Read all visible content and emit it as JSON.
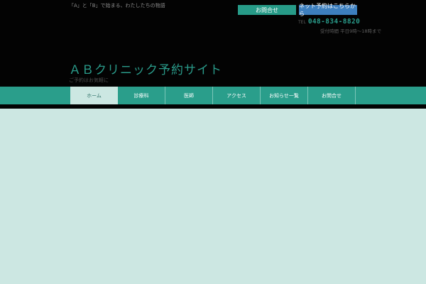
{
  "header": {
    "tagline": "「A」と「B」で始まる、わたしたちの物語",
    "contact_label": "お問合せ",
    "reserve_label": "ネット予約はこちらから",
    "phone_label": "TEL",
    "phone_number": "048-834-8820",
    "hours": "受付時間 平日9時〜18時まで",
    "site_title": "ＡＢクリニック予約サイト",
    "site_subtitle": "ご予約はお気軽に"
  },
  "nav": {
    "items": [
      {
        "label": "ホーム",
        "active": true
      },
      {
        "label": "診療科"
      },
      {
        "label": "医師"
      },
      {
        "label": "アクセス"
      },
      {
        "label": "お知らせ一覧"
      },
      {
        "label": "お問合せ"
      }
    ]
  },
  "colors": {
    "accent": "#2a9e8b",
    "reserve_button": "#3d7fbe",
    "header_bg": "#030303",
    "page_bg": "#cce7e2"
  }
}
